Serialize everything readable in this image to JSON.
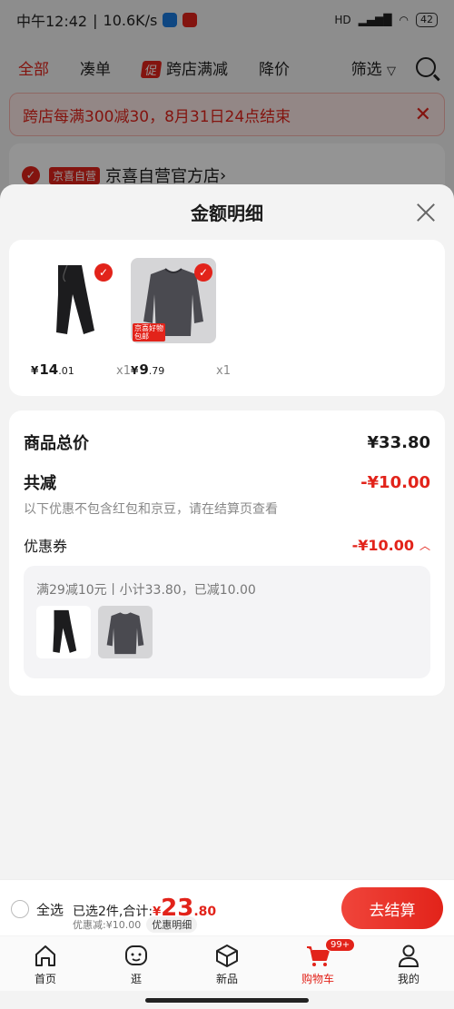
{
  "status_bar": {
    "time": "中午12:42",
    "speed": "10.6K/s",
    "network": "HD",
    "battery": "42"
  },
  "filter_bar": {
    "tabs": [
      "全部",
      "凑单",
      "跨店满减",
      "降价",
      "筛选"
    ],
    "promo_tag": "促"
  },
  "notice": {
    "text": "跨店每满300减30，8月31日24点结束"
  },
  "shop": {
    "tag": "京喜自营",
    "name": "京喜自营官方店"
  },
  "sheet": {
    "title": "金额明细",
    "products": [
      {
        "price_int": "14",
        "price_dec": ".01",
        "qty": "x1"
      },
      {
        "price_int": "9",
        "price_dec": ".79",
        "qty": "x1",
        "tag": "包邮",
        "tag_top": "京喜好物"
      }
    ],
    "currency": "¥",
    "total_label": "商品总价",
    "total_value": "¥33.80",
    "discount_label": "共减",
    "discount_value": "-¥10.00",
    "discount_note": "以下优惠不包含红包和京豆，请在结算页查看",
    "coupon_label": "优惠券",
    "coupon_value": "-¥10.00",
    "coupon_desc": "满29减10元丨小计33.80，已减10.00"
  },
  "checkout": {
    "select_all": "全选",
    "selected_text": "已选2件,合计:",
    "total_int": "23",
    "total_dec": ".80",
    "currency": "¥",
    "saving": "优惠减:¥10.00",
    "detail_label": "优惠明细",
    "button": "去结算"
  },
  "tabbar": {
    "items": [
      "首页",
      "逛",
      "新品",
      "购物车",
      "我的"
    ],
    "cart_badge": "99+"
  },
  "colors": {
    "accent": "#e2231a"
  }
}
